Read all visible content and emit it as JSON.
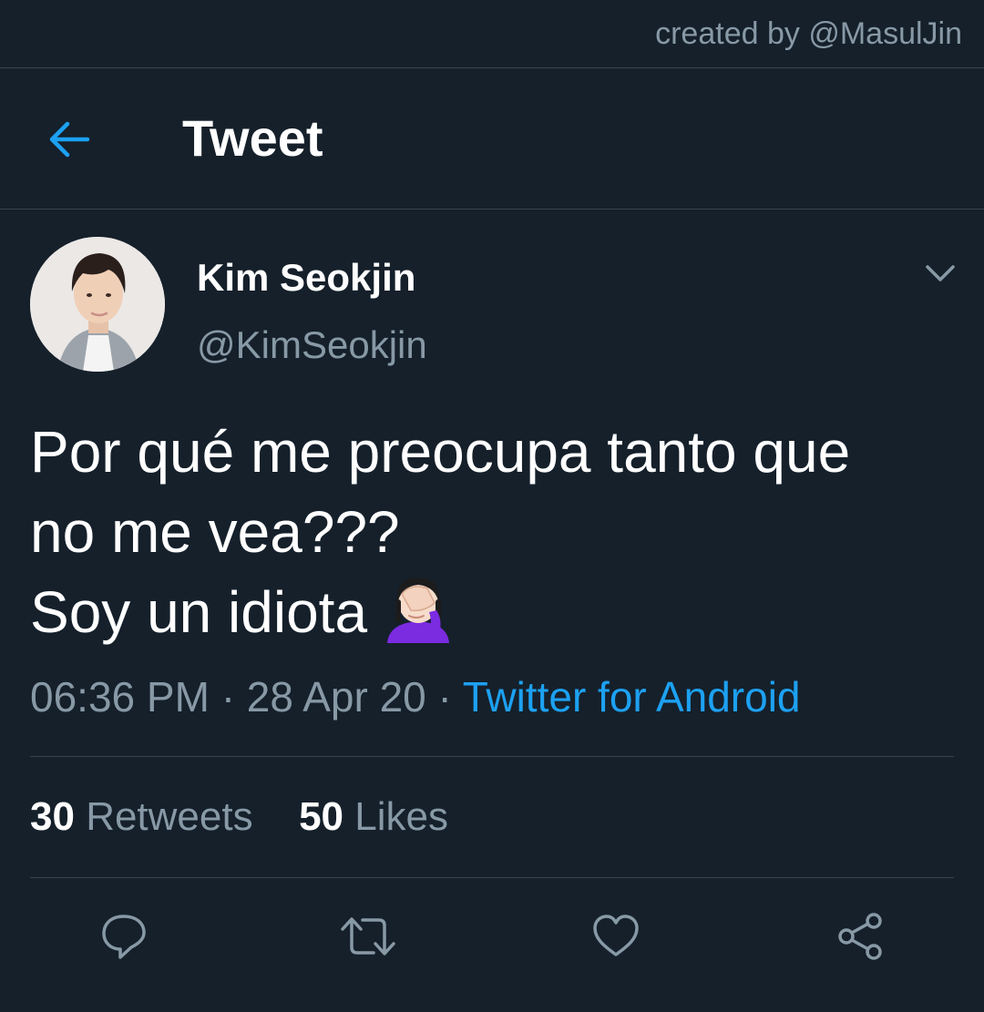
{
  "credit": "created by @MasulJin",
  "header": {
    "title": "Tweet",
    "back_icon": "arrow-left-icon"
  },
  "author": {
    "name": "Kim Seokjin",
    "handle": "@KimSeokjin"
  },
  "tweet": {
    "lines": [
      "Por qué me preocupa tanto que",
      "no me vea???",
      "Soy un idiota"
    ],
    "emoji": "face-palm-icon"
  },
  "meta": {
    "time": "06:36 PM",
    "separator": "·",
    "date": "28 Apr 20",
    "source": "Twitter for Android"
  },
  "stats": {
    "retweets_count": "30",
    "retweets_label": "Retweets",
    "likes_count": "50",
    "likes_label": "Likes"
  },
  "actions": [
    "reply-icon",
    "retweet-icon",
    "like-icon",
    "share-icon"
  ],
  "colors": {
    "background": "#15202b",
    "divider": "#38444d",
    "secondary_text": "#8899a6",
    "accent": "#1da1f2"
  }
}
